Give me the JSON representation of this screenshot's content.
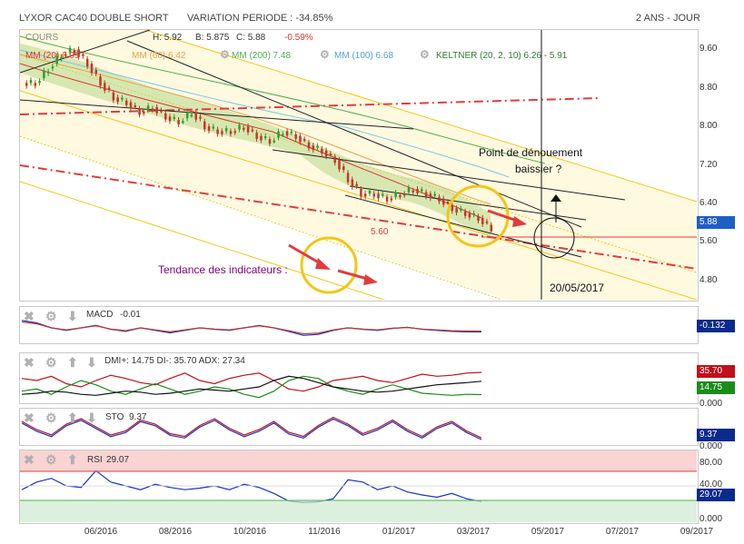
{
  "header": {
    "title": "LYXOR CAC40 DOUBLE SHORT",
    "variation": "VARIATION PERIODE : -34.85%",
    "period": "2 ANS - JOUR"
  },
  "main_legend": {
    "cours": "COURS",
    "h": "H: 5.92",
    "b": "B: 5.875",
    "c": "C: 5.88",
    "c_change": "-0.59%",
    "mm20": "MM (20) 6.09",
    "mm60": "MM (60) 6.42",
    "mm200": "MM (200) 7.48",
    "mm100": "MM (100) 6.68",
    "keltner": "KELTNER (20, 2, 10) 6.26 - 5.91"
  },
  "annotations": {
    "point": "Point de dénouement",
    "baissier": "baissier ?",
    "tendance": "Tendance des indicateurs :",
    "level": "5.60",
    "date": "20/05/2017"
  },
  "colors": {
    "up": "#2e9e2e",
    "down": "#c0392b",
    "channel": "#f3c515",
    "red_dash": "#e23b3b",
    "blue_tag": "#1f5fc4",
    "navy_tag": "#0a2a8c",
    "dmi_minus_tag": "#c0101a",
    "dmi_plus_tag": "#1a8c1a"
  },
  "chart_data": [
    {
      "type": "line",
      "title": "LYXOR CAC40 DOUBLE SHORT",
      "x_ticks": [
        "06/2016",
        "08/2016",
        "10/2016",
        "11/2016",
        "01/2017",
        "03/2017",
        "05/2017",
        "07/2017",
        "09/2017"
      ],
      "y_ticks": [
        "9.60",
        "8.80",
        "8.00",
        "7.20",
        "6.40",
        "5.60",
        "4.80"
      ],
      "ylim": [
        4.4,
        10.0
      ],
      "last_value": "5.88",
      "series": [
        {
          "name": "COURS",
          "values": [
            8.9,
            9.2,
            9.5,
            9.6,
            9.3,
            8.9,
            8.6,
            8.5,
            8.3,
            8.4,
            8.2,
            8.1,
            8.3,
            8.0,
            7.9,
            7.9,
            8.0,
            7.8,
            7.7,
            7.9,
            7.8,
            7.6,
            7.5,
            7.3,
            6.9,
            6.6,
            6.6,
            6.5,
            6.6,
            6.7,
            6.6,
            6.5,
            6.3,
            6.2,
            6.1,
            5.88
          ]
        },
        {
          "name": "MM (200)",
          "values": [
            9.5,
            9.4,
            9.3,
            9.2,
            9.1,
            9.0,
            8.9,
            8.8,
            8.7,
            8.6,
            8.5,
            8.45,
            8.4,
            8.35,
            8.3,
            8.25,
            8.2,
            8.15,
            8.1,
            8.05,
            8.0,
            7.95,
            7.9,
            7.85,
            7.8,
            7.75,
            7.7,
            7.65,
            7.6,
            7.58,
            7.56,
            7.54,
            7.52,
            7.5,
            7.49,
            7.48
          ]
        }
      ]
    },
    {
      "type": "line",
      "title": "MACD",
      "value_label": "-0.01",
      "tag": "-0.132",
      "series": [
        {
          "name": "MACD",
          "values": [
            0.1,
            0.05,
            -0.05,
            -0.1,
            -0.05,
            0.0,
            -0.08,
            -0.12,
            -0.05,
            -0.1,
            -0.15,
            -0.1,
            -0.05,
            -0.08,
            -0.1,
            -0.05,
            0.0,
            -0.05,
            -0.12,
            -0.2,
            -0.18,
            -0.1,
            -0.05,
            -0.08,
            -0.1,
            -0.06,
            -0.04,
            -0.08,
            -0.1,
            -0.12,
            -0.13,
            -0.132
          ]
        }
      ]
    },
    {
      "type": "line",
      "title": "DMI",
      "label_text": "DMI+: 14.75 DI-: 35.70 ADX: 27.34",
      "di_minus": "35.70",
      "di_plus": "14.75",
      "zero": "0.000",
      "series": [
        {
          "name": "DI-",
          "values": [
            30,
            28,
            32,
            25,
            22,
            28,
            33,
            30,
            26,
            24,
            30,
            35,
            28,
            25,
            30,
            33,
            35,
            28,
            20,
            18,
            22,
            28,
            30,
            32,
            28,
            26,
            30,
            34,
            32,
            33,
            35,
            35.7
          ]
        },
        {
          "name": "DI+",
          "values": [
            18,
            20,
            15,
            22,
            28,
            24,
            18,
            15,
            20,
            25,
            20,
            15,
            18,
            22,
            20,
            15,
            12,
            18,
            28,
            32,
            30,
            22,
            18,
            15,
            20,
            24,
            20,
            16,
            15,
            14,
            15,
            14.75
          ]
        },
        {
          "name": "ADX",
          "values": [
            15,
            16,
            18,
            17,
            15,
            14,
            16,
            18,
            17,
            15,
            16,
            18,
            20,
            19,
            18,
            20,
            22,
            28,
            32,
            30,
            26,
            22,
            20,
            18,
            17,
            18,
            20,
            22,
            24,
            25,
            26,
            27.34
          ]
        }
      ]
    },
    {
      "type": "line",
      "title": "STO",
      "value_label": "9.37",
      "tag": "9.37",
      "zero": "0.000",
      "series": [
        {
          "name": "STO",
          "values": [
            70,
            40,
            20,
            60,
            80,
            50,
            20,
            35,
            75,
            60,
            25,
            15,
            55,
            80,
            45,
            20,
            40,
            70,
            30,
            15,
            55,
            85,
            60,
            25,
            45,
            75,
            40,
            15,
            50,
            70,
            35,
            9.37
          ]
        }
      ]
    },
    {
      "type": "line",
      "title": "RSI",
      "value_label": "29.07",
      "tag": "29.07",
      "y_ticks": [
        "80.00",
        "40.00",
        "0.000"
      ],
      "series": [
        {
          "name": "RSI",
          "values": [
            45,
            55,
            60,
            50,
            48,
            70,
            55,
            50,
            45,
            52,
            48,
            45,
            47,
            50,
            45,
            52,
            48,
            40,
            30,
            28,
            29,
            33,
            58,
            55,
            45,
            50,
            42,
            38,
            35,
            40,
            33,
            29.07
          ]
        }
      ]
    }
  ]
}
